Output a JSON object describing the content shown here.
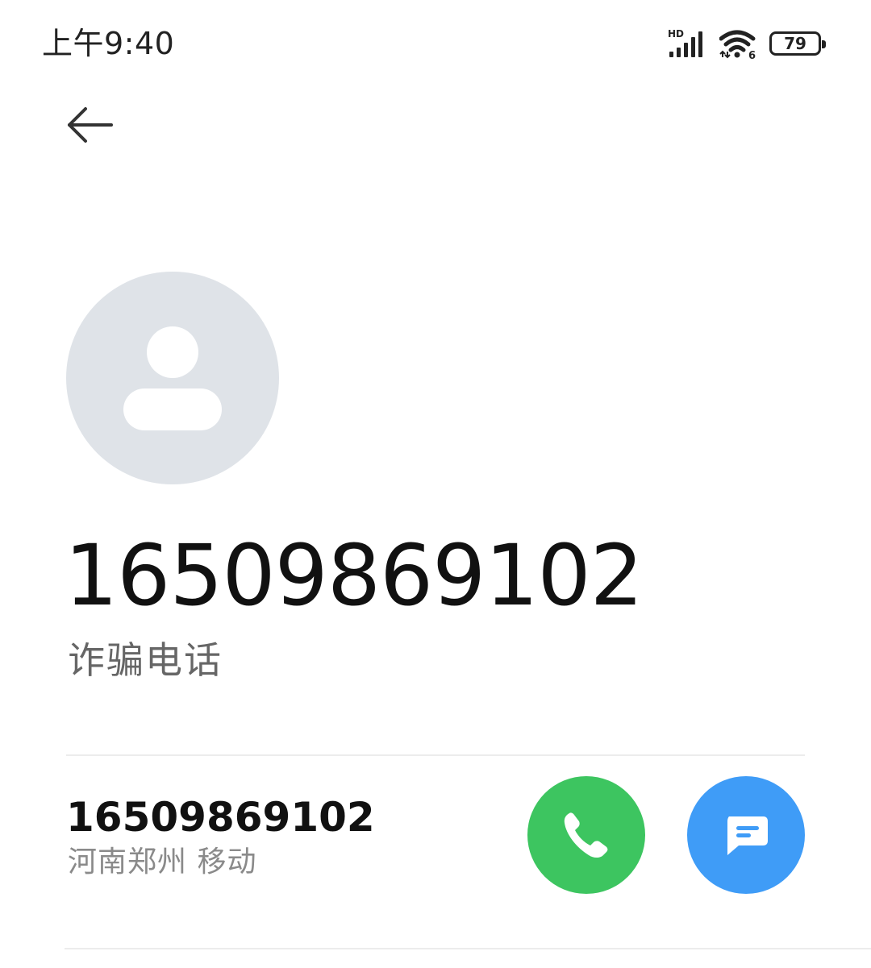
{
  "status_bar": {
    "time": "上午9:40",
    "network_label": "HD",
    "wifi_label": "6",
    "battery_level": "79",
    "icons": [
      "signal-icon",
      "wifi-icon",
      "battery-icon"
    ]
  },
  "header": {
    "back_icon": "back-arrow-icon"
  },
  "contact": {
    "avatar_icon": "person-icon",
    "phone_number": "16509869102",
    "tag": "诈骗电话"
  },
  "number_row": {
    "phone_number": "16509869102",
    "location": "河南郑州 移动",
    "call_icon": "phone-icon",
    "message_icon": "message-icon"
  },
  "colors": {
    "call_button": "#3dc560",
    "message_button": "#3f9cf7",
    "avatar_background": "#dfe3e8"
  }
}
